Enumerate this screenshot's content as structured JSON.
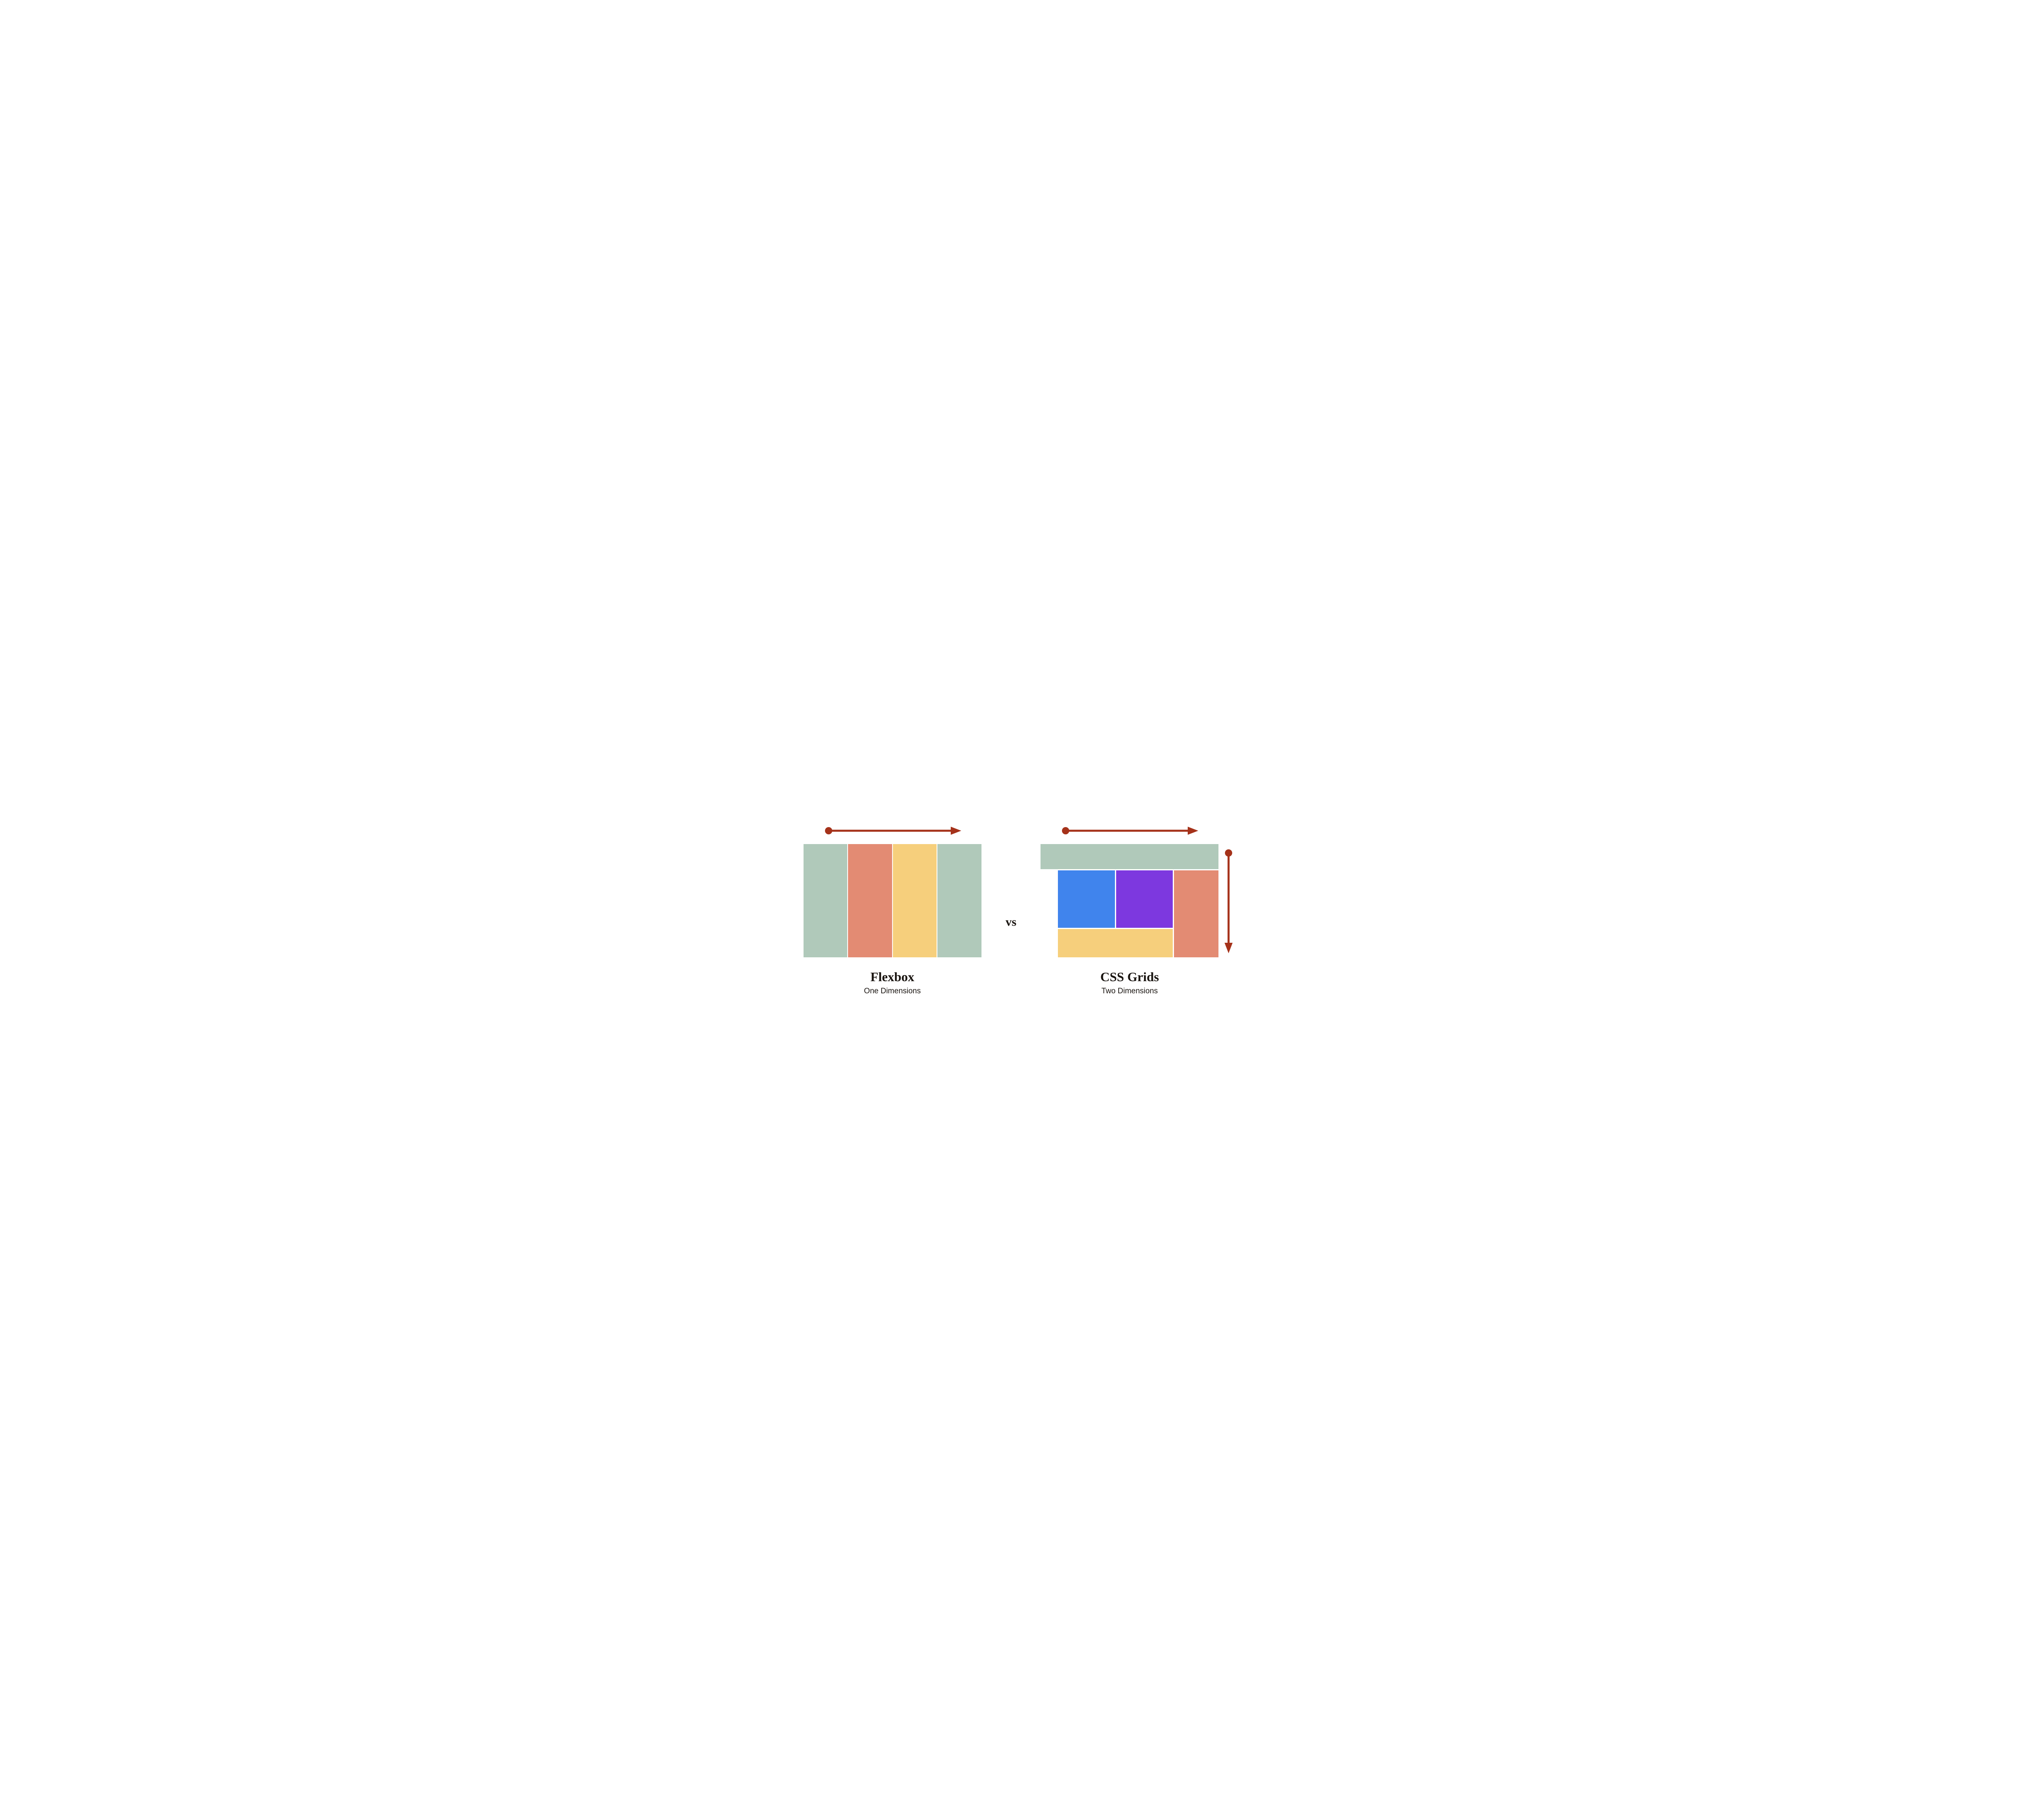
{
  "colors": {
    "arrow": "#a5321a",
    "sage": "#b0c9ba",
    "salmon": "#e38b73",
    "sand": "#f6cf7c",
    "blue": "#4084ed",
    "purple": "#7d38df"
  },
  "left": {
    "title": "Flexbox",
    "subtitle": "One Dimensions",
    "columns": [
      "sage",
      "salmon",
      "sand",
      "sage"
    ]
  },
  "center": {
    "label": "vs"
  },
  "right": {
    "title": "CSS Grids",
    "subtitle": "Two Dimensions",
    "cells": {
      "header": "sage",
      "left_gutter": "white",
      "blue": "blue",
      "purple": "purple",
      "right": "salmon",
      "footer": "sand"
    }
  }
}
